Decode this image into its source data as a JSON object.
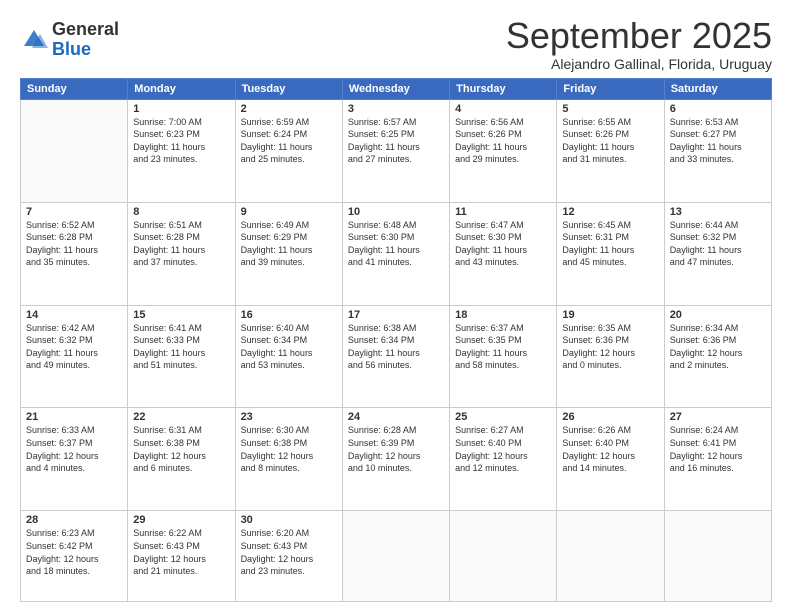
{
  "header": {
    "logo_line1": "General",
    "logo_line2": "Blue",
    "month": "September 2025",
    "location": "Alejandro Gallinal, Florida, Uruguay"
  },
  "weekdays": [
    "Sunday",
    "Monday",
    "Tuesday",
    "Wednesday",
    "Thursday",
    "Friday",
    "Saturday"
  ],
  "weeks": [
    [
      {
        "day": "",
        "detail": ""
      },
      {
        "day": "1",
        "detail": "Sunrise: 7:00 AM\nSunset: 6:23 PM\nDaylight: 11 hours\nand 23 minutes."
      },
      {
        "day": "2",
        "detail": "Sunrise: 6:59 AM\nSunset: 6:24 PM\nDaylight: 11 hours\nand 25 minutes."
      },
      {
        "day": "3",
        "detail": "Sunrise: 6:57 AM\nSunset: 6:25 PM\nDaylight: 11 hours\nand 27 minutes."
      },
      {
        "day": "4",
        "detail": "Sunrise: 6:56 AM\nSunset: 6:26 PM\nDaylight: 11 hours\nand 29 minutes."
      },
      {
        "day": "5",
        "detail": "Sunrise: 6:55 AM\nSunset: 6:26 PM\nDaylight: 11 hours\nand 31 minutes."
      },
      {
        "day": "6",
        "detail": "Sunrise: 6:53 AM\nSunset: 6:27 PM\nDaylight: 11 hours\nand 33 minutes."
      }
    ],
    [
      {
        "day": "7",
        "detail": "Sunrise: 6:52 AM\nSunset: 6:28 PM\nDaylight: 11 hours\nand 35 minutes."
      },
      {
        "day": "8",
        "detail": "Sunrise: 6:51 AM\nSunset: 6:28 PM\nDaylight: 11 hours\nand 37 minutes."
      },
      {
        "day": "9",
        "detail": "Sunrise: 6:49 AM\nSunset: 6:29 PM\nDaylight: 11 hours\nand 39 minutes."
      },
      {
        "day": "10",
        "detail": "Sunrise: 6:48 AM\nSunset: 6:30 PM\nDaylight: 11 hours\nand 41 minutes."
      },
      {
        "day": "11",
        "detail": "Sunrise: 6:47 AM\nSunset: 6:30 PM\nDaylight: 11 hours\nand 43 minutes."
      },
      {
        "day": "12",
        "detail": "Sunrise: 6:45 AM\nSunset: 6:31 PM\nDaylight: 11 hours\nand 45 minutes."
      },
      {
        "day": "13",
        "detail": "Sunrise: 6:44 AM\nSunset: 6:32 PM\nDaylight: 11 hours\nand 47 minutes."
      }
    ],
    [
      {
        "day": "14",
        "detail": "Sunrise: 6:42 AM\nSunset: 6:32 PM\nDaylight: 11 hours\nand 49 minutes."
      },
      {
        "day": "15",
        "detail": "Sunrise: 6:41 AM\nSunset: 6:33 PM\nDaylight: 11 hours\nand 51 minutes."
      },
      {
        "day": "16",
        "detail": "Sunrise: 6:40 AM\nSunset: 6:34 PM\nDaylight: 11 hours\nand 53 minutes."
      },
      {
        "day": "17",
        "detail": "Sunrise: 6:38 AM\nSunset: 6:34 PM\nDaylight: 11 hours\nand 56 minutes."
      },
      {
        "day": "18",
        "detail": "Sunrise: 6:37 AM\nSunset: 6:35 PM\nDaylight: 11 hours\nand 58 minutes."
      },
      {
        "day": "19",
        "detail": "Sunrise: 6:35 AM\nSunset: 6:36 PM\nDaylight: 12 hours\nand 0 minutes."
      },
      {
        "day": "20",
        "detail": "Sunrise: 6:34 AM\nSunset: 6:36 PM\nDaylight: 12 hours\nand 2 minutes."
      }
    ],
    [
      {
        "day": "21",
        "detail": "Sunrise: 6:33 AM\nSunset: 6:37 PM\nDaylight: 12 hours\nand 4 minutes."
      },
      {
        "day": "22",
        "detail": "Sunrise: 6:31 AM\nSunset: 6:38 PM\nDaylight: 12 hours\nand 6 minutes."
      },
      {
        "day": "23",
        "detail": "Sunrise: 6:30 AM\nSunset: 6:38 PM\nDaylight: 12 hours\nand 8 minutes."
      },
      {
        "day": "24",
        "detail": "Sunrise: 6:28 AM\nSunset: 6:39 PM\nDaylight: 12 hours\nand 10 minutes."
      },
      {
        "day": "25",
        "detail": "Sunrise: 6:27 AM\nSunset: 6:40 PM\nDaylight: 12 hours\nand 12 minutes."
      },
      {
        "day": "26",
        "detail": "Sunrise: 6:26 AM\nSunset: 6:40 PM\nDaylight: 12 hours\nand 14 minutes."
      },
      {
        "day": "27",
        "detail": "Sunrise: 6:24 AM\nSunset: 6:41 PM\nDaylight: 12 hours\nand 16 minutes."
      }
    ],
    [
      {
        "day": "28",
        "detail": "Sunrise: 6:23 AM\nSunset: 6:42 PM\nDaylight: 12 hours\nand 18 minutes."
      },
      {
        "day": "29",
        "detail": "Sunrise: 6:22 AM\nSunset: 6:43 PM\nDaylight: 12 hours\nand 21 minutes."
      },
      {
        "day": "30",
        "detail": "Sunrise: 6:20 AM\nSunset: 6:43 PM\nDaylight: 12 hours\nand 23 minutes."
      },
      {
        "day": "",
        "detail": ""
      },
      {
        "day": "",
        "detail": ""
      },
      {
        "day": "",
        "detail": ""
      },
      {
        "day": "",
        "detail": ""
      }
    ]
  ]
}
